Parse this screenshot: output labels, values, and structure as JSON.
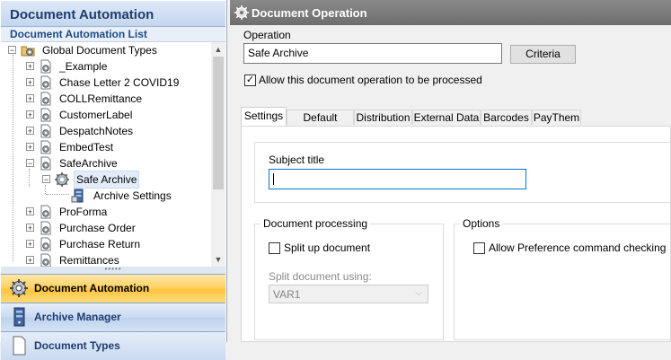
{
  "left": {
    "title": "Document Automation",
    "subtitle": "Document Automation List",
    "tree": [
      {
        "label": "Global Document Types",
        "expander": "−"
      },
      {
        "label": "_Example",
        "expander": "+"
      },
      {
        "label": "Chase Letter 2 COVID19",
        "expander": "+"
      },
      {
        "label": "COLLRemittance",
        "expander": "+"
      },
      {
        "label": "CustomerLabel",
        "expander": "+"
      },
      {
        "label": "DespatchNotes",
        "expander": "+"
      },
      {
        "label": "EmbedTest",
        "expander": "+"
      },
      {
        "label": "SafeArchive",
        "expander": "−"
      },
      {
        "label": "Safe Archive",
        "expander": "−"
      },
      {
        "label": "Archive Settings",
        "expander": ""
      },
      {
        "label": "ProForma",
        "expander": "+"
      },
      {
        "label": "Purchase Order",
        "expander": "+"
      },
      {
        "label": "Purchase Return",
        "expander": "+"
      },
      {
        "label": "Remittances",
        "expander": "+"
      }
    ],
    "scroll_up": "▲",
    "scroll_down": "▼",
    "splitter_grip": "•••••",
    "nav": [
      {
        "label": "Document Automation",
        "icon": "gear-icon"
      },
      {
        "label": "Archive Manager",
        "icon": "server-icon"
      },
      {
        "label": "Document Types",
        "icon": "document-icon"
      }
    ]
  },
  "right": {
    "title": "Document Operation",
    "operation_label": "Operation",
    "operation_value": "Safe Archive",
    "criteria_button": "Criteria",
    "allow_checkbox_label": "Allow this document operation to be processed",
    "allow_checked": true,
    "check_mark": "✓",
    "tabs": [
      "Settings",
      "Default Forms",
      "Distribution",
      "External Data",
      "Barcodes",
      "PayThem"
    ],
    "active_tab": "Settings",
    "subject_title_label": "Subject title",
    "subject_title_value": "",
    "doc_processing_group": "Document processing",
    "split_label": "Split up document",
    "split_checked": false,
    "split_using_label": "Split document using:",
    "split_using_value": "VAR1",
    "options_group": "Options",
    "allow_pref_label": "Allow Preference command checking",
    "allow_pref_checked": false
  }
}
